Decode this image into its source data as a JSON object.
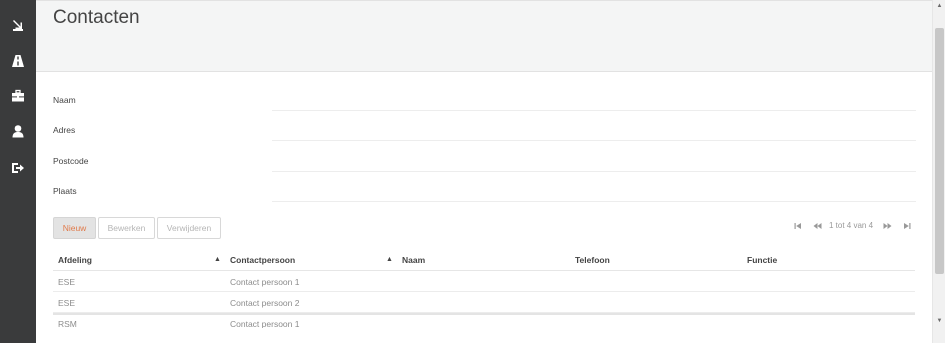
{
  "sidebar": {
    "items": [
      {
        "icon": "download-icon"
      },
      {
        "icon": "road-icon"
      },
      {
        "icon": "briefcase-icon"
      },
      {
        "icon": "user-icon"
      },
      {
        "icon": "logout-icon"
      }
    ]
  },
  "page": {
    "title": "Contacten"
  },
  "form": {
    "fields": [
      {
        "label": "Naam",
        "value": ""
      },
      {
        "label": "Adres",
        "value": ""
      },
      {
        "label": "Postcode",
        "value": ""
      },
      {
        "label": "Plaats",
        "value": ""
      }
    ]
  },
  "toolbar": {
    "new_label": "Nieuw",
    "edit_label": "Bewerken",
    "delete_label": "Verwijderen"
  },
  "pager": {
    "info": "1 tot 4 van 4"
  },
  "table": {
    "columns": [
      "Afdeling",
      "Contactpersoon",
      "Naam",
      "Telefoon",
      "Functie"
    ],
    "sort_icon": "▲",
    "rows": [
      {
        "afdeling": "ESE",
        "contactpersoon": "Contact persoon 1",
        "naam": "",
        "telefoon": "",
        "functie": ""
      },
      {
        "afdeling": "ESE",
        "contactpersoon": "Contact persoon 2",
        "naam": "",
        "telefoon": "",
        "functie": ""
      },
      {
        "afdeling": "RSM",
        "contactpersoon": "Contact persoon 1",
        "naam": "",
        "telefoon": "",
        "functie": ""
      }
    ]
  },
  "colors": {
    "sidebar": "#3a3b3c",
    "accent": "#e07a4a",
    "header_bg": "#f4f5f5"
  }
}
